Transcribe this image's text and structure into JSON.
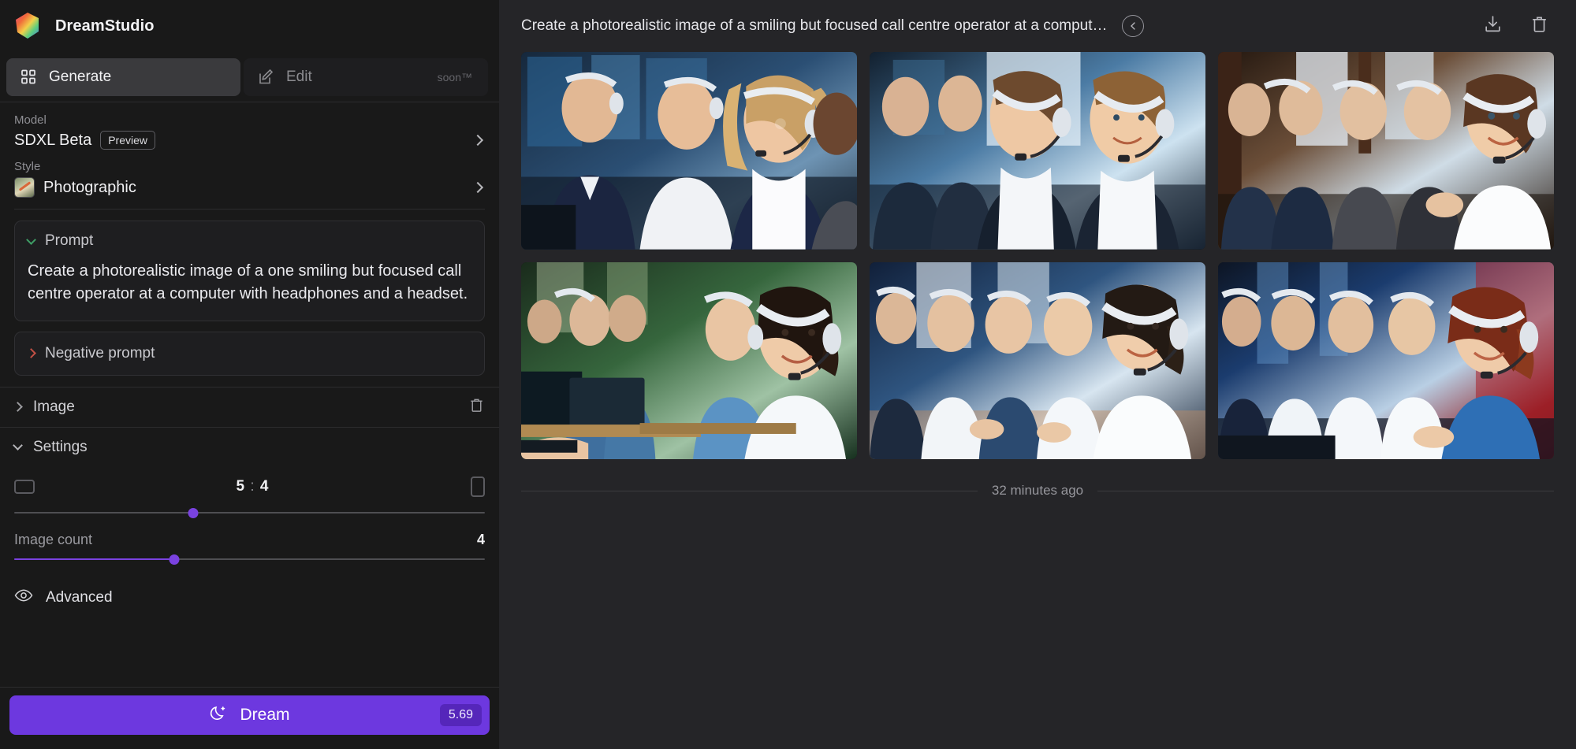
{
  "brand": {
    "name": "DreamStudio",
    "logo_icon": "dreamstudio-hex-logo"
  },
  "tabs": [
    {
      "label": "Generate",
      "icon": "grid-squares-icon",
      "active": true,
      "badge": ""
    },
    {
      "label": "Edit",
      "icon": "pencil-square-icon",
      "active": false,
      "badge": "soon™"
    }
  ],
  "model": {
    "label": "Model",
    "value": "SDXL Beta",
    "badge": "Preview",
    "chevron_icon": "chevron-right-icon"
  },
  "style": {
    "label": "Style",
    "value": "Photographic",
    "thumb_icon": "style-thumbnail-photographic",
    "chevron_icon": "chevron-right-icon"
  },
  "prompt": {
    "title": "Prompt",
    "expanded": true,
    "chevron_icon": "chevron-down-icon",
    "text": "Create a photorealistic image of a one smiling but focused call centre operator at a computer with headphones and a headset."
  },
  "negative_prompt": {
    "title": "Negative prompt",
    "expanded": false,
    "chevron_icon": "chevron-right-icon"
  },
  "image_section": {
    "title": "Image",
    "expanded": false,
    "chevron_icon": "chevron-right-icon",
    "delete_icon": "trash-icon"
  },
  "settings": {
    "title": "Settings",
    "expanded": true,
    "chevron_icon": "chevron-down-icon",
    "aspect_ratio": {
      "value": "5 : 4",
      "w": "5",
      "sep": ":",
      "h": "4",
      "left_icon": "landscape-frame-icon",
      "right_icon": "portrait-frame-icon",
      "slider_percent": 38
    },
    "image_count": {
      "label": "Image count",
      "value": "4",
      "slider_percent": 34
    }
  },
  "advanced": {
    "label": "Advanced",
    "icon": "eye-icon"
  },
  "dream_button": {
    "label": "Dream",
    "icon": "moon-sparkle-icon",
    "credits": "5.69"
  },
  "main": {
    "title": "Create a photorealistic image of a smiling but focused call centre operator at a comput…",
    "back_icon": "arrow-left-circle-icon",
    "download_icon": "download-icon",
    "delete_icon": "trash-icon",
    "timestamp": "32 minutes ago",
    "results": [
      {
        "alt": "Call centre team in suits with headsets, blonde woman smiling in foreground",
        "palette": [
          "#14202e",
          "#2d4663",
          "#a9c4d8",
          "#e8c9a8",
          "#1b2636"
        ]
      },
      {
        "alt": "Two male call centre operators with headsets smiling, bright window behind",
        "palette": [
          "#0f1a26",
          "#3a5a7a",
          "#cfe2ef",
          "#eccfb0",
          "#16202c"
        ]
      },
      {
        "alt": "Row of call centre operators in dark suits, woman in white shirt at right",
        "palette": [
          "#1c1410",
          "#5a4434",
          "#cfdde8",
          "#eed4b8",
          "#241a14"
        ]
      },
      {
        "alt": "Call centre desks with monitors, woman in white blouse typing, green background",
        "palette": [
          "#16251a",
          "#2f5a3a",
          "#b9d0c0",
          "#e7cbb0",
          "#10301c"
        ]
      },
      {
        "alt": "Row of smiling women operators with headsets at long desk",
        "palette": [
          "#101b2a",
          "#2c4a6b",
          "#dfe9f2",
          "#f0d3b6",
          "#14202f"
        ]
      },
      {
        "alt": "Call centre row with red lighting, woman in blue blouse at keyboard",
        "palette": [
          "#0d1524",
          "#1b3c6e",
          "#dfe8f2",
          "#f0d2b4",
          "#5a1418"
        ]
      }
    ]
  },
  "colors": {
    "accent_purple": "#6d38df",
    "slider_purple": "#7a42e0",
    "sidebar_bg": "#191919",
    "main_bg": "#252528",
    "prompt_chevron_green": "#3f9e66",
    "negative_chevron_red": "#c25045"
  }
}
